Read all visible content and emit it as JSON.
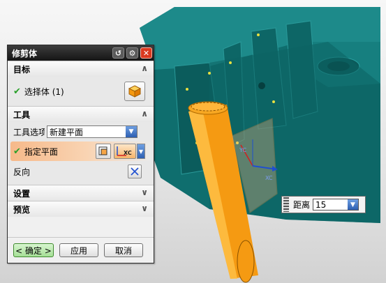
{
  "dialog": {
    "title": "修剪体",
    "sections": {
      "target": {
        "label": "目标",
        "select_body": "选择体 (1)"
      },
      "tool": {
        "label": "工具",
        "tool_option_label": "工具选项",
        "tool_option_value": "新建平面",
        "specify_plane": "指定平面",
        "reverse": "反向"
      },
      "settings": {
        "label": "设置"
      },
      "preview": {
        "label": "预览"
      }
    },
    "buttons": {
      "ok": "< 确定 >",
      "apply": "应用",
      "cancel": "取消"
    }
  },
  "distance": {
    "label": "距离",
    "value": "15"
  },
  "scene": {
    "axis_labels": [
      "YC",
      "XC"
    ]
  }
}
